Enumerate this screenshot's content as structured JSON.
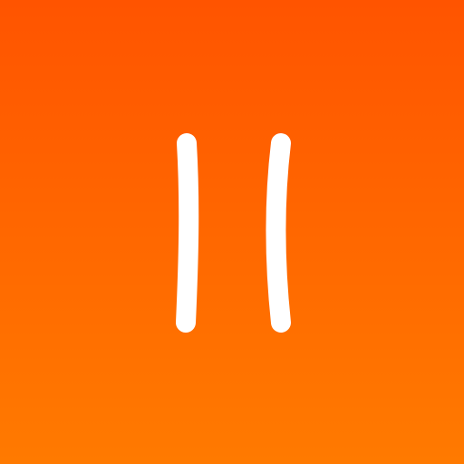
{
  "icon": {
    "name": "pause-icon",
    "colors": {
      "background_top": "#FF5400",
      "background_bottom": "#FF7A00",
      "glyph": "#FFFFFF"
    }
  }
}
